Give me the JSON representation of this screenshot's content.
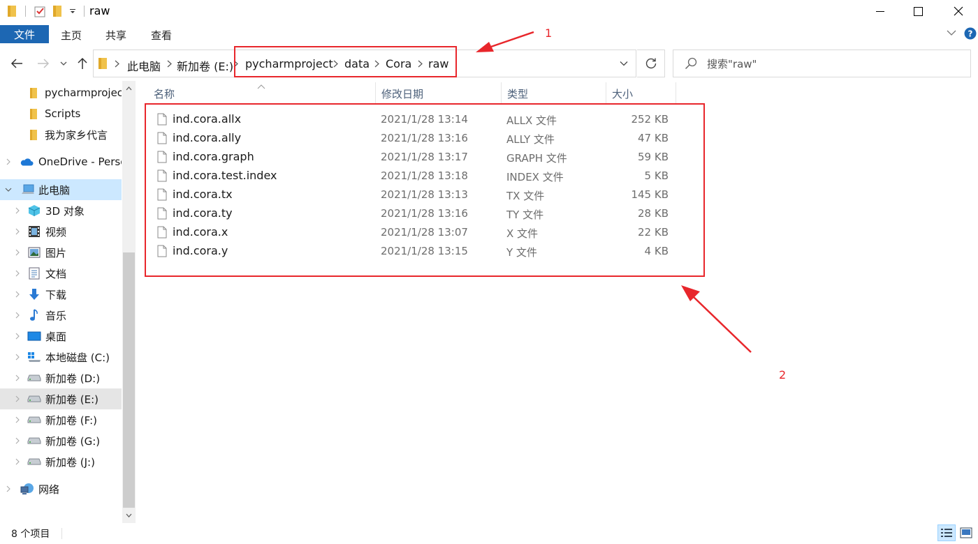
{
  "window": {
    "title": "raw",
    "minimize_icon": "minimize-icon",
    "maximize_icon": "maximize-icon",
    "close_icon": "close-icon"
  },
  "ribbon": {
    "tabs": [
      "文件",
      "主页",
      "共享",
      "查看"
    ]
  },
  "address": {
    "crumbs": [
      "此电脑",
      "新加卷 (E:)",
      "pycharmproject",
      "data",
      "Cora",
      "raw"
    ]
  },
  "search": {
    "placeholder": "搜索\"raw\""
  },
  "nav": {
    "items": [
      {
        "label": "pycharmproject",
        "icon": "folder-icon"
      },
      {
        "label": "Scripts",
        "icon": "folder-icon"
      },
      {
        "label": "我为家乡代言",
        "icon": "folder-icon"
      },
      {
        "label": "OneDrive - Personal",
        "icon": "onedrive-cloud-icon"
      },
      {
        "label": "此电脑",
        "icon": "this-pc-icon"
      },
      {
        "label": "3D 对象",
        "icon": "3d-objects-icon"
      },
      {
        "label": "视频",
        "icon": "video-icon"
      },
      {
        "label": "图片",
        "icon": "pictures-icon"
      },
      {
        "label": "文档",
        "icon": "documents-icon"
      },
      {
        "label": "下载",
        "icon": "download-icon"
      },
      {
        "label": "音乐",
        "icon": "music-icon"
      },
      {
        "label": "桌面",
        "icon": "desktop-icon"
      },
      {
        "label": "本地磁盘 (C:)",
        "icon": "system-drive-icon"
      },
      {
        "label": "新加卷 (D:)",
        "icon": "drive-icon"
      },
      {
        "label": "新加卷 (E:)",
        "icon": "drive-icon"
      },
      {
        "label": "新加卷 (F:)",
        "icon": "drive-icon"
      },
      {
        "label": "新加卷 (G:)",
        "icon": "drive-icon"
      },
      {
        "label": "新加卷 (J:)",
        "icon": "drive-icon"
      },
      {
        "label": "网络",
        "icon": "network-icon"
      }
    ]
  },
  "columns": {
    "name": "名称",
    "date": "修改日期",
    "type": "类型",
    "size": "大小"
  },
  "files": [
    {
      "name": "ind.cora.allx",
      "date": "2021/1/28 13:14",
      "type": "ALLX 文件",
      "size": "252 KB"
    },
    {
      "name": "ind.cora.ally",
      "date": "2021/1/28 13:16",
      "type": "ALLY 文件",
      "size": "47 KB"
    },
    {
      "name": "ind.cora.graph",
      "date": "2021/1/28 13:17",
      "type": "GRAPH 文件",
      "size": "59 KB"
    },
    {
      "name": "ind.cora.test.index",
      "date": "2021/1/28 13:18",
      "type": "INDEX 文件",
      "size": "5 KB"
    },
    {
      "name": "ind.cora.tx",
      "date": "2021/1/28 13:13",
      "type": "TX 文件",
      "size": "145 KB"
    },
    {
      "name": "ind.cora.ty",
      "date": "2021/1/28 13:16",
      "type": "TY 文件",
      "size": "28 KB"
    },
    {
      "name": "ind.cora.x",
      "date": "2021/1/28 13:07",
      "type": "X 文件",
      "size": "22 KB"
    },
    {
      "name": "ind.cora.y",
      "date": "2021/1/28 13:15",
      "type": "Y 文件",
      "size": "4 KB"
    }
  ],
  "annotations": {
    "label_1": "1",
    "label_2": "2",
    "color": "#e8262b"
  },
  "status": {
    "count": "8 个项目"
  },
  "colors": {
    "accent": "#1d67b3",
    "selection": "#cce8ff",
    "folder": "#f0c24b"
  }
}
